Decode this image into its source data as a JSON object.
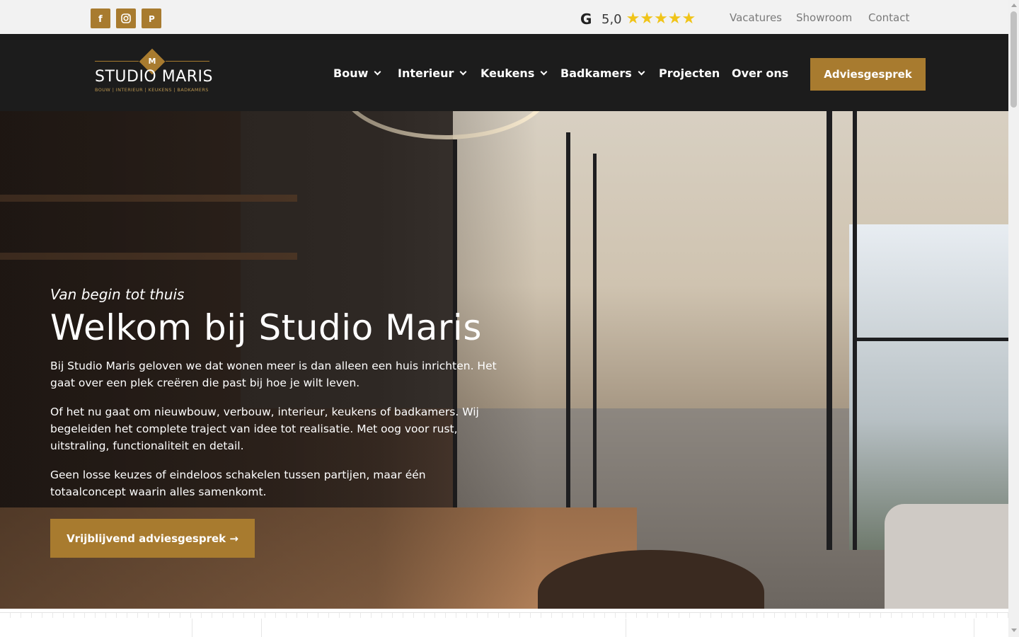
{
  "colors": {
    "accent": "#a87b2f",
    "header_bg": "#1c1c1c",
    "topbar_bg": "#f2f2f2",
    "star": "#f0c419"
  },
  "topbar": {
    "social": [
      {
        "icon": "facebook-icon",
        "glyph": "f"
      },
      {
        "icon": "instagram-icon"
      },
      {
        "icon": "pinterest-icon",
        "glyph": "P"
      }
    ],
    "rating": {
      "logo": "G",
      "score": "5,0",
      "stars": "★★★★★",
      "star_count": 5
    },
    "links": [
      "Vacatures",
      "Showroom",
      "Contact"
    ]
  },
  "header": {
    "logo": {
      "mark": "M",
      "name": "STUDIO MARIS",
      "tagline": "BOUW | INTERIEUR | KEUKENS | BADKAMERS"
    },
    "nav": [
      {
        "label": "Bouw",
        "dropdown": true
      },
      {
        "label": "Interieur",
        "dropdown": true
      },
      {
        "label": "Keukens",
        "dropdown": true
      },
      {
        "label": "Badkamers",
        "dropdown": true
      },
      {
        "label": "Projecten",
        "dropdown": false
      },
      {
        "label": "Over ons",
        "dropdown": false
      }
    ],
    "cta": "Adviesgesprek"
  },
  "hero": {
    "kicker": "Van begin tot thuis",
    "title": "Welkom bij Studio Maris",
    "paragraphs": [
      "Bij Studio Maris geloven we dat wonen meer is dan alleen een huis inrichten. Het gaat over een plek creëren die past bij hoe je wilt leven.",
      "Of het nu gaat om nieuwbouw, verbouw, interieur, keukens of badkamers. Wij begeleiden het complete traject van idee tot realisatie. Met oog voor rust, uitstraling, functionaliteit en detail.",
      "Geen losse keuzes of eindeloos schakelen tussen partijen, maar één totaalconcept waarin alles samenkomt."
    ],
    "cta": "Vrijblijvend adviesgesprek →"
  }
}
